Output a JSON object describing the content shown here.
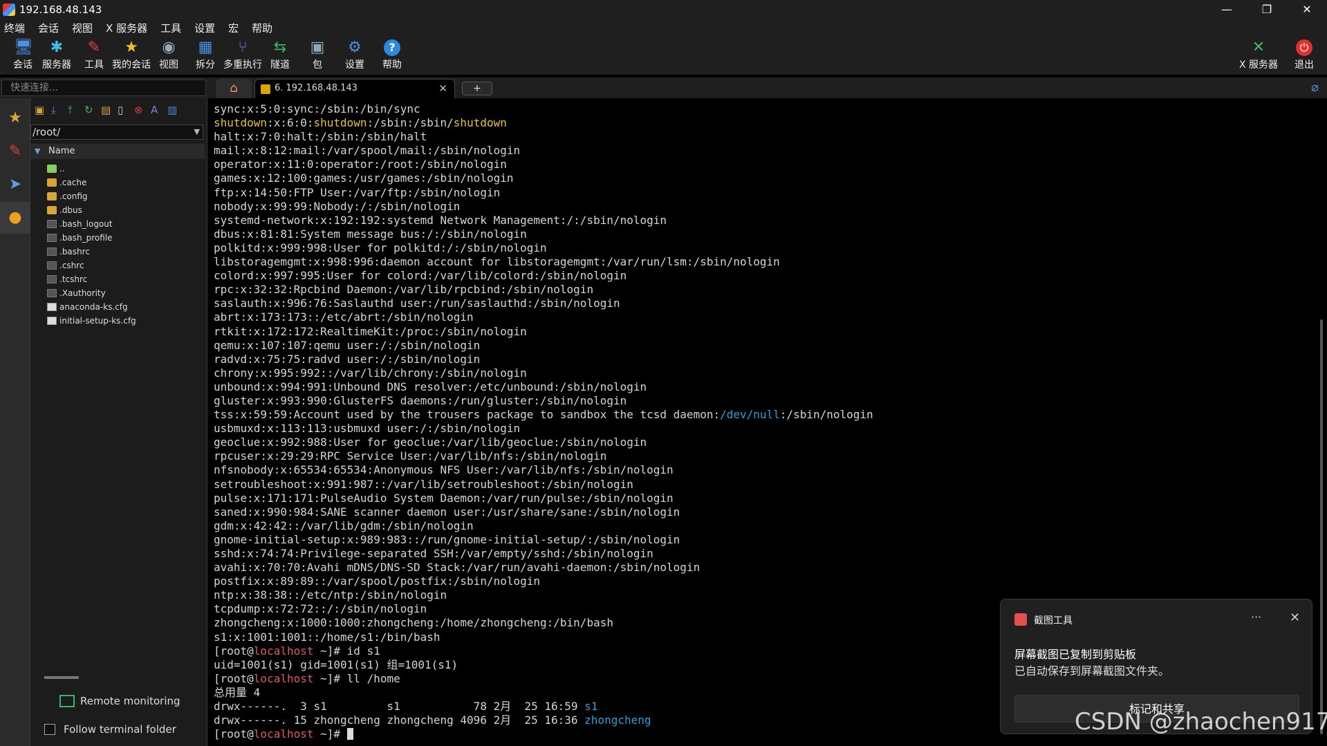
{
  "window": {
    "title": "192.168.48.143",
    "minimize": "—",
    "restore": "❐",
    "close": "✕"
  },
  "menu": [
    "终端",
    "会话",
    "视图",
    "X 服务器",
    "工具",
    "设置",
    "宏",
    "帮助"
  ],
  "toolbar": [
    {
      "label": "会话",
      "icon": "session-icon"
    },
    {
      "label": "服务器",
      "icon": "server-icon"
    },
    {
      "label": "工具",
      "icon": "tools-icon"
    },
    {
      "label": "我的会话",
      "icon": "star-icon"
    },
    {
      "label": "视图",
      "icon": "view-icon"
    },
    {
      "label": "拆分",
      "icon": "split-icon"
    },
    {
      "label": "多重执行",
      "icon": "multiexec-icon"
    },
    {
      "label": "隧道",
      "icon": "tunnel-icon"
    },
    {
      "label": "包",
      "icon": "package-icon"
    },
    {
      "label": "设置",
      "icon": "settings-icon"
    },
    {
      "label": "帮助",
      "icon": "help-icon"
    }
  ],
  "toolbar_right": [
    {
      "label": "X 服务器",
      "icon": "xserver-icon"
    },
    {
      "label": "退出",
      "icon": "exit-icon"
    }
  ],
  "quick_connect": {
    "placeholder": "快速连接..."
  },
  "tabs": {
    "session_label": "6. 192.168.48.143",
    "new_tab": "+"
  },
  "sftp": {
    "path": "/root/",
    "column": "Name",
    "files": [
      {
        "name": "..",
        "kind": "up"
      },
      {
        "name": ".cache",
        "kind": "folder"
      },
      {
        "name": ".config",
        "kind": "folder"
      },
      {
        "name": ".dbus",
        "kind": "folder"
      },
      {
        "name": ".bash_logout",
        "kind": "file"
      },
      {
        "name": ".bash_profile",
        "kind": "file"
      },
      {
        "name": ".bashrc",
        "kind": "file"
      },
      {
        "name": ".cshrc",
        "kind": "file"
      },
      {
        "name": ".tcshrc",
        "kind": "file"
      },
      {
        "name": ".Xauthority",
        "kind": "file"
      },
      {
        "name": "anaconda-ks.cfg",
        "kind": "doc"
      },
      {
        "name": "initial-setup-ks.cfg",
        "kind": "doc"
      }
    ],
    "remote_monitoring": "Remote monitoring",
    "follow_terminal": "Follow terminal folder"
  },
  "terminal": {
    "colors": {
      "yellow": "#e8c23a",
      "red": "#e05a5a",
      "blue": "#2aa0d8"
    },
    "lines": [
      [
        {
          "t": "sync:x:5:0:sync:/sbin:/bin/sync"
        }
      ],
      [
        {
          "t": "shutdown",
          "c": "y"
        },
        {
          "t": ":x:6:0:"
        },
        {
          "t": "shutdown",
          "c": "y"
        },
        {
          "t": ":/sbin:/sbin/"
        },
        {
          "t": "shutdown",
          "c": "y"
        }
      ],
      [
        {
          "t": "halt:x:7:0:halt:/sbin:/sbin/halt"
        }
      ],
      [
        {
          "t": "mail:x:8:12:mail:/var/spool/mail:/sbin/nologin"
        }
      ],
      [
        {
          "t": "operator:x:11:0:operator:/root:/sbin/nologin"
        }
      ],
      [
        {
          "t": "games:x:12:100:games:/usr/games:/sbin/nologin"
        }
      ],
      [
        {
          "t": "ftp:x:14:50:FTP User:/var/ftp:/sbin/nologin"
        }
      ],
      [
        {
          "t": "nobody:x:99:99:Nobody:/:/sbin/nologin"
        }
      ],
      [
        {
          "t": "systemd-network:x:192:192:systemd Network Management:/:/sbin/nologin"
        }
      ],
      [
        {
          "t": "dbus:x:81:81:System message bus:/:/sbin/nologin"
        }
      ],
      [
        {
          "t": "polkitd:x:999:998:User for polkitd:/:/sbin/nologin"
        }
      ],
      [
        {
          "t": "libstoragemgmt:x:998:996:daemon account for libstoragemgmt:/var/run/lsm:/sbin/nologin"
        }
      ],
      [
        {
          "t": "colord:x:997:995:User for colord:/var/lib/colord:/sbin/nologin"
        }
      ],
      [
        {
          "t": "rpc:x:32:32:Rpcbind Daemon:/var/lib/rpcbind:/sbin/nologin"
        }
      ],
      [
        {
          "t": "saslauth:x:996:76:Saslauthd user:/run/saslauthd:/sbin/nologin"
        }
      ],
      [
        {
          "t": "abrt:x:173:173::/etc/abrt:/sbin/nologin"
        }
      ],
      [
        {
          "t": "rtkit:x:172:172:RealtimeKit:/proc:/sbin/nologin"
        }
      ],
      [
        {
          "t": "qemu:x:107:107:qemu user:/:/sbin/nologin"
        }
      ],
      [
        {
          "t": "radvd:x:75:75:radvd user:/:/sbin/nologin"
        }
      ],
      [
        {
          "t": "chrony:x:995:992::/var/lib/chrony:/sbin/nologin"
        }
      ],
      [
        {
          "t": "unbound:x:994:991:Unbound DNS resolver:/etc/unbound:/sbin/nologin"
        }
      ],
      [
        {
          "t": "gluster:x:993:990:GlusterFS daemons:/run/gluster:/sbin/nologin"
        }
      ],
      [
        {
          "t": "tss:x:59:59:Account used by the trousers package to sandbox the tcsd daemon:"
        },
        {
          "t": "/dev/null",
          "c": "b"
        },
        {
          "t": ":/sbin/nologin"
        }
      ],
      [
        {
          "t": "usbmuxd:x:113:113:usbmuxd user:/:/sbin/nologin"
        }
      ],
      [
        {
          "t": "geoclue:x:992:988:User for geoclue:/var/lib/geoclue:/sbin/nologin"
        }
      ],
      [
        {
          "t": "rpcuser:x:29:29:RPC Service User:/var/lib/nfs:/sbin/nologin"
        }
      ],
      [
        {
          "t": "nfsnobody:x:65534:65534:Anonymous NFS User:/var/lib/nfs:/sbin/nologin"
        }
      ],
      [
        {
          "t": "setroubleshoot:x:991:987::/var/lib/setroubleshoot:/sbin/nologin"
        }
      ],
      [
        {
          "t": "pulse:x:171:171:PulseAudio System Daemon:/var/run/pulse:/sbin/nologin"
        }
      ],
      [
        {
          "t": "saned:x:990:984:SANE scanner daemon user:/usr/share/sane:/sbin/nologin"
        }
      ],
      [
        {
          "t": "gdm:x:42:42::/var/lib/gdm:/sbin/nologin"
        }
      ],
      [
        {
          "t": "gnome-initial-setup:x:989:983::/run/gnome-initial-setup/:/sbin/nologin"
        }
      ],
      [
        {
          "t": "sshd:x:74:74:Privilege-separated SSH:/var/empty/sshd:/sbin/nologin"
        }
      ],
      [
        {
          "t": "avahi:x:70:70:Avahi mDNS/DNS-SD Stack:/var/run/avahi-daemon:/sbin/nologin"
        }
      ],
      [
        {
          "t": "postfix:x:89:89::/var/spool/postfix:/sbin/nologin"
        }
      ],
      [
        {
          "t": "ntp:x:38:38::/etc/ntp:/sbin/nologin"
        }
      ],
      [
        {
          "t": "tcpdump:x:72:72::/:/sbin/nologin"
        }
      ],
      [
        {
          "t": "zhongcheng:x:1000:1000:zhongcheng:/home/zhongcheng:/bin/bash"
        }
      ],
      [
        {
          "t": "s1:x:1001:1001::/home/s1:/bin/bash"
        }
      ],
      [
        {
          "t": "[root@"
        },
        {
          "t": "localhost",
          "c": "r"
        },
        {
          "t": " ~]# id s1"
        }
      ],
      [
        {
          "t": "uid=1001(s1) gid=1001(s1) 组=1001(s1)"
        }
      ],
      [
        {
          "t": "[root@"
        },
        {
          "t": "localhost",
          "c": "r"
        },
        {
          "t": " ~]# ll /home"
        }
      ],
      [
        {
          "t": "总用量 4"
        }
      ],
      [
        {
          "t": "drwx------.  3 s1         s1           78 2月  25 16:59 "
        },
        {
          "t": "s1",
          "c": "b"
        }
      ],
      [
        {
          "t": "drwx------. 15 zhongcheng zhongcheng 4096 2月  25 16:36 "
        },
        {
          "t": "zhongcheng",
          "c": "b"
        }
      ],
      [
        {
          "t": "[root@"
        },
        {
          "t": "localhost",
          "c": "r"
        },
        {
          "t": " ~]# "
        },
        {
          "cursor": true
        }
      ]
    ]
  },
  "notification": {
    "app": "截图工具",
    "more": "···",
    "close": "✕",
    "heading": "屏幕截图已复制到剪贴板",
    "body": "已自动保存到屏幕截图文件夹。",
    "action": "标记和共享"
  },
  "watermark": "CSDN @zhaochen917"
}
